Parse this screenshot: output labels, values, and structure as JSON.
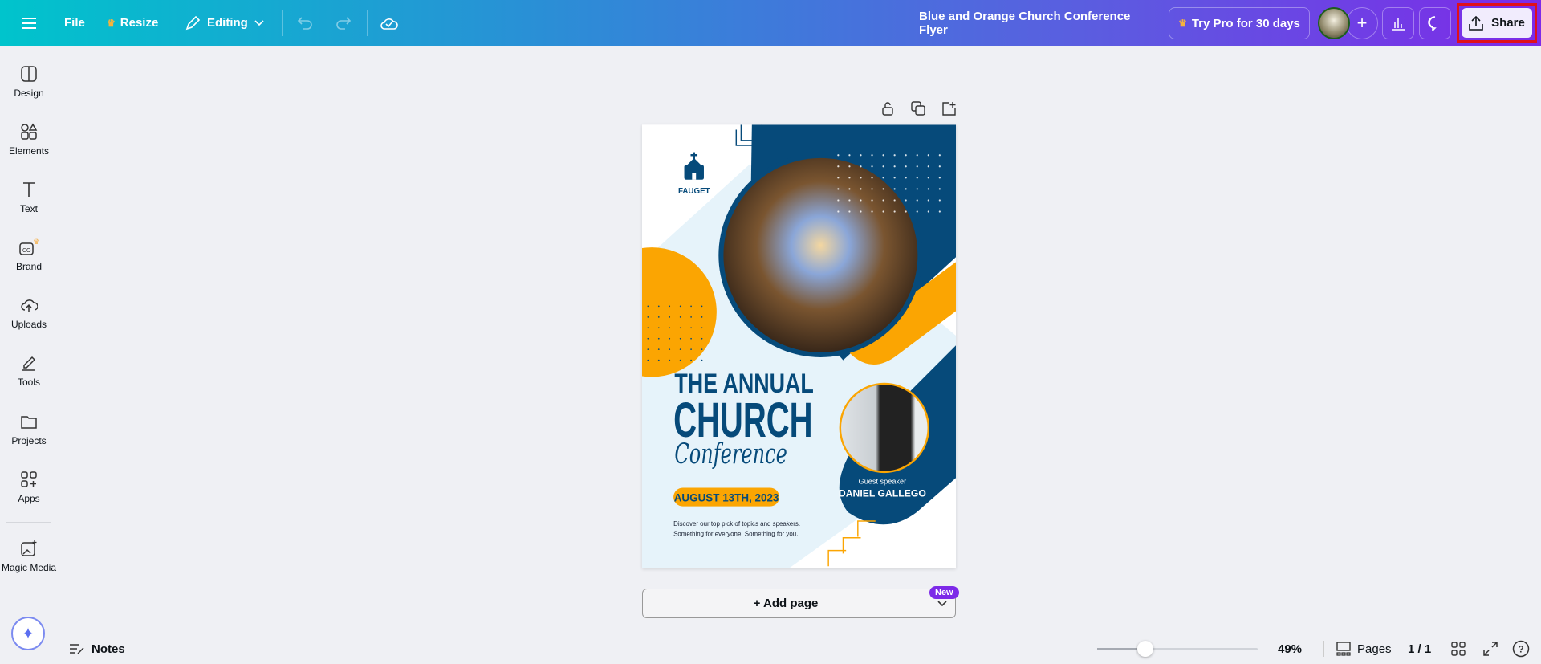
{
  "topbar": {
    "file": "File",
    "resize": "Resize",
    "editing": "Editing",
    "title": "Blue and Orange Church Conference Flyer",
    "try_pro": "Try Pro for 30 days",
    "share": "Share"
  },
  "sidebar": {
    "items": [
      {
        "label": "Design"
      },
      {
        "label": "Elements"
      },
      {
        "label": "Text"
      },
      {
        "label": "Brand"
      },
      {
        "label": "Uploads"
      },
      {
        "label": "Tools"
      },
      {
        "label": "Projects"
      },
      {
        "label": "Apps"
      },
      {
        "label": "Magic Media"
      }
    ]
  },
  "flyer": {
    "logo": "FAUGET",
    "line1": "THE ANNUAL",
    "line2": "CHURCH",
    "line3": "Conference",
    "date": "AUGUST 13TH, 2023",
    "desc1": "Discover our top pick of topics and speakers.",
    "desc2": "Something for everyone. Something for you.",
    "guest_label": "Guest speaker",
    "guest_name": "DANIEL GALLEGO"
  },
  "canvas": {
    "add_page": "+ Add page",
    "new_badge": "New"
  },
  "footer": {
    "notes": "Notes",
    "zoom": "49%",
    "zoom_fraction": 0.3,
    "pages": "Pages",
    "page_count": "1 / 1"
  },
  "colors": {
    "navy": "#064a7a",
    "orange": "#fba502",
    "light_blue": "#e6f3fa"
  }
}
